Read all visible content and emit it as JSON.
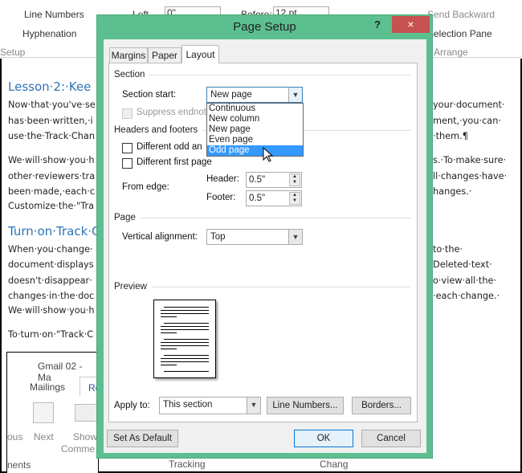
{
  "ribbon": {
    "line_numbers": "Line Numbers",
    "hyphenation": "Hyphenation",
    "setup": "Setup",
    "left": "Left",
    "left_value": "0\"",
    "before": "Before:",
    "before_value": "12 pt",
    "send_backward": "Send Backward",
    "selection_pane": "Selection Pane",
    "arrange": "Arrange"
  },
  "document": {
    "heading1": "Lesson·2:·Kee",
    "p1": [
      "Now·that·you've·se",
      "has·been·written,·i",
      "use·the·Track·Chan"
    ],
    "p1r": [
      "your·document·",
      "ment,·you·can·",
      "·them.¶"
    ],
    "p2": [
      "We·will·show·you·h",
      "other·reviewers·tra",
      "been·made,·each·c",
      "Customize·the·\"Tra"
    ],
    "p2r": [
      "s.·To·make·sure·",
      "ll·changes·have·",
      "hanges.·"
    ],
    "heading2": "Turn·on·Track·Ch",
    "p3": [
      "When·you·change·",
      "document·displays",
      "doesn't·disappear·",
      "changes·in·the·doc",
      "We·will·show·you·h"
    ],
    "p3r": [
      "to·the·",
      "Deleted·text·",
      "o·view·all·the·",
      "·each·change.·"
    ],
    "p4": "To·turn·on·\"Track·C",
    "embedded": {
      "title": "Gmail 02 - Ma",
      "tab_mailings": "Mailings",
      "tab_review": "Re",
      "previous": "ous",
      "next": "Next",
      "show_comments": "Show",
      "show_comments2": "Comme",
      "comments_group": "nents",
      "tracking_group": "Tracking",
      "changes_group": "Chang"
    }
  },
  "dialog": {
    "title": "Page Setup",
    "help": "?",
    "close": "×",
    "tabs": [
      "Margins",
      "Paper",
      "Layout"
    ],
    "active_tab": "Layout",
    "section": {
      "label": "Section",
      "section_start_label": "Section start:",
      "section_start_value": "New page",
      "options": [
        "Continuous",
        "New column",
        "New page",
        "Even page",
        "Odd page"
      ],
      "highlighted": "Odd page",
      "suppress_endnotes": "Suppress endnot"
    },
    "headers_footers": {
      "label": "Headers and footers",
      "diff_odd_even": "Different odd an",
      "diff_first": "Different first page",
      "from_edge": "From edge:",
      "header_label": "Header:",
      "header_value": "0.5\"",
      "footer_label": "Footer:",
      "footer_value": "0.5\""
    },
    "page": {
      "label": "Page",
      "vertical_alignment_label": "Vertical alignment:",
      "vertical_alignment_value": "Top"
    },
    "preview": {
      "label": "Preview"
    },
    "apply_to_label": "Apply to:",
    "apply_to_value": "This section",
    "line_numbers_button": "Line Numbers...",
    "borders_button": "Borders...",
    "set_default_button": "Set As Default",
    "ok_button": "OK",
    "cancel_button": "Cancel"
  }
}
